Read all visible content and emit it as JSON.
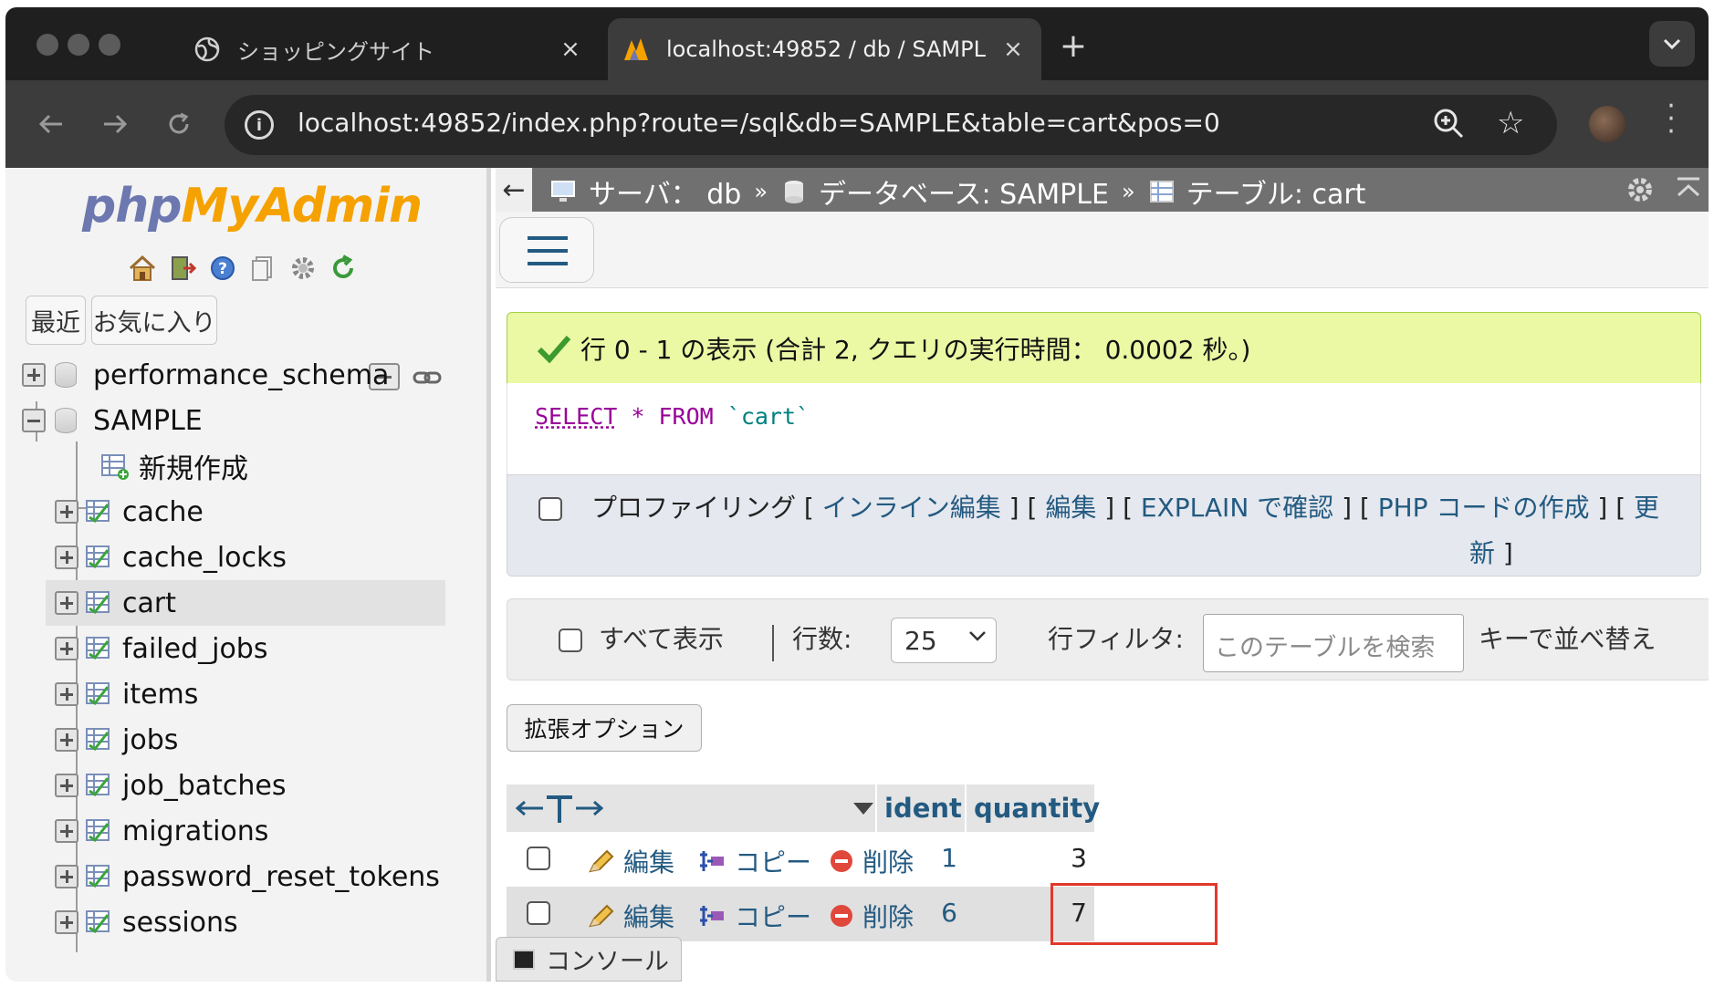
{
  "browser": {
    "tabs": [
      {
        "title": "ショッピングサイト",
        "icon": "globe-icon"
      },
      {
        "title": "localhost:49852 / db / SAMPL",
        "icon": "phpmyadmin-favicon"
      }
    ],
    "close_glyph": "×",
    "new_tab_glyph": "+",
    "url": "localhost:49852/index.php?route=/sql&db=SAMPLE&table=cart&pos=0"
  },
  "sidebar": {
    "logo_php": "php",
    "logo_myadmin": "MyAdmin",
    "recent_label": "最近",
    "favorites_label": "お気に入り",
    "tree": [
      {
        "label": "performance_schema",
        "type": "db",
        "expanded": false
      },
      {
        "label": "SAMPLE",
        "type": "db",
        "expanded": true
      },
      {
        "label": "新規作成",
        "type": "new"
      },
      {
        "label": "cache",
        "type": "table"
      },
      {
        "label": "cache_locks",
        "type": "table"
      },
      {
        "label": "cart",
        "type": "table",
        "selected": true
      },
      {
        "label": "failed_jobs",
        "type": "table"
      },
      {
        "label": "items",
        "type": "table"
      },
      {
        "label": "jobs",
        "type": "table"
      },
      {
        "label": "job_batches",
        "type": "table"
      },
      {
        "label": "migrations",
        "type": "table"
      },
      {
        "label": "password_reset_tokens",
        "type": "table"
      },
      {
        "label": "sessions",
        "type": "table"
      }
    ]
  },
  "breadcrumb": {
    "server": "サーバ： db",
    "database": "データベース: SAMPLE",
    "table": "テーブル: cart",
    "separator": "»"
  },
  "result": {
    "message": "行 0 - 1 の表示 (合計 2, クエリの実行時間： 0.0002 秒。)",
    "sql_select": "SELECT",
    "sql_star": "*",
    "sql_from": "FROM",
    "sql_table": "`cart`",
    "profiling": "プロファイリング",
    "links": [
      "インライン編集",
      "編集",
      "EXPLAIN で確認",
      "PHP コードの作成",
      "更新"
    ],
    "link_last_line2": "新"
  },
  "navigation": {
    "show_all": "すべて表示",
    "rows_label": "行数:",
    "rows_value": "25",
    "filter_label": "行フィルタ:",
    "filter_placeholder": "このテーブルを検索",
    "sort_label": "キーで並べ替え"
  },
  "extra_options_label": "拡張オプション",
  "table": {
    "columns": [
      "ident",
      "quantity"
    ],
    "actions": {
      "edit": "編集",
      "copy": "コピー",
      "delete": "削除"
    },
    "rows": [
      {
        "ident": "1",
        "quantity": "3"
      },
      {
        "ident": "6",
        "quantity": "7"
      }
    ]
  },
  "console_label": "コンソール",
  "colors": {
    "accent_link": "#235a81",
    "highlight": "#e0392b",
    "success_bg": "#ebf8a4"
  }
}
